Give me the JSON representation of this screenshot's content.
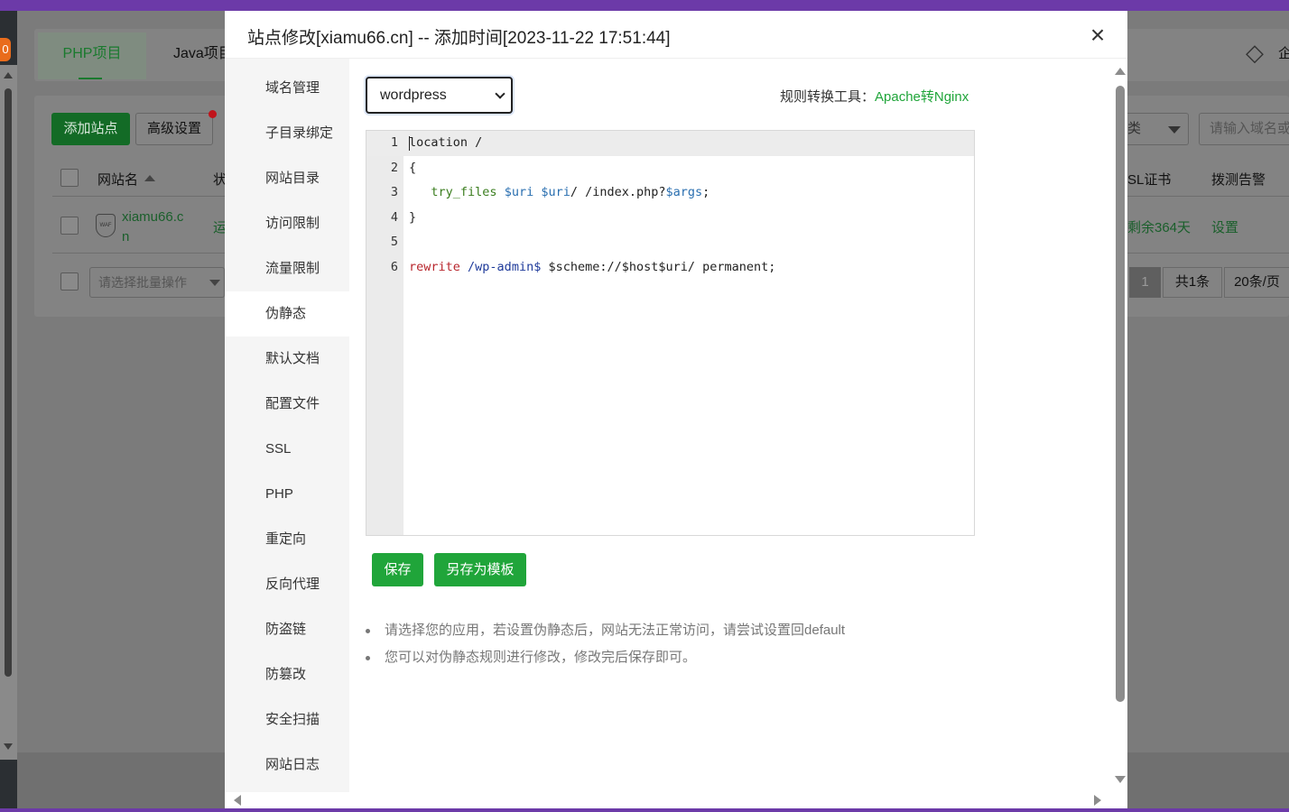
{
  "background": {
    "tabs": [
      {
        "label": "PHP项目",
        "active": true
      },
      {
        "label": "Java项目",
        "active": false
      }
    ],
    "toolbar": {
      "add_site": "添加站点",
      "advanced": "高级设置",
      "category_partial": "类",
      "search_placeholder": "请输入域名或"
    },
    "table": {
      "headers": [
        "网站名",
        "状",
        "SL证书",
        "拨测告警"
      ],
      "rows": [
        {
          "name": "xiamu66.cn",
          "name_line1": "xiamu66.c",
          "name_line2": "n",
          "status": "运",
          "ssl": "剩余364天",
          "ssl_partial": "剩余364天",
          "alarm": "设置"
        }
      ],
      "waf_label": "WAF"
    },
    "batch_placeholder": "请选择批量操作",
    "pagination": {
      "current": "1",
      "total": "共1条",
      "per_page": "20条/页"
    },
    "leftnav_badge": "0",
    "corner_partial": "企"
  },
  "modal": {
    "title": "站点修改[xiamu66.cn] -- 添加时间[2023-11-22 17:51:44]",
    "close": "×",
    "sidebar": [
      {
        "label": "域名管理",
        "active": false
      },
      {
        "label": "子目录绑定",
        "active": false
      },
      {
        "label": "网站目录",
        "active": false
      },
      {
        "label": "访问限制",
        "active": false
      },
      {
        "label": "流量限制",
        "active": false
      },
      {
        "label": "伪静态",
        "active": true
      },
      {
        "label": "默认文档",
        "active": false
      },
      {
        "label": "配置文件",
        "active": false
      },
      {
        "label": "SSL",
        "active": false
      },
      {
        "label": "PHP",
        "active": false
      },
      {
        "label": "重定向",
        "active": false
      },
      {
        "label": "反向代理",
        "active": false
      },
      {
        "label": "防盗链",
        "active": false
      },
      {
        "label": "防篡改",
        "active": false
      },
      {
        "label": "安全扫描",
        "active": false
      },
      {
        "label": "网站日志",
        "active": false
      }
    ],
    "rewrite": {
      "selected_template": "wordpress",
      "tool_label": "规则转换工具：",
      "tool_link": "Apache转Nginx",
      "code_lines": [
        "location /",
        "{",
        "   try_files $uri $uri/ /index.php?$args;",
        "}",
        "",
        "rewrite /wp-admin$ $scheme://$host$uri/ permanent;"
      ],
      "save_button": "保存",
      "save_template_button": "另存为模板",
      "tips": [
        "请选择您的应用，若设置伪静态后，网站无法正常访问，请尝试设置回default",
        "您可以对伪静态规则进行修改，修改完后保存即可。"
      ]
    }
  },
  "colors": {
    "accent_green": "#20a53a",
    "top_bar_purple": "#6c3aa8",
    "overlay_gray": "#7b7b7b"
  }
}
